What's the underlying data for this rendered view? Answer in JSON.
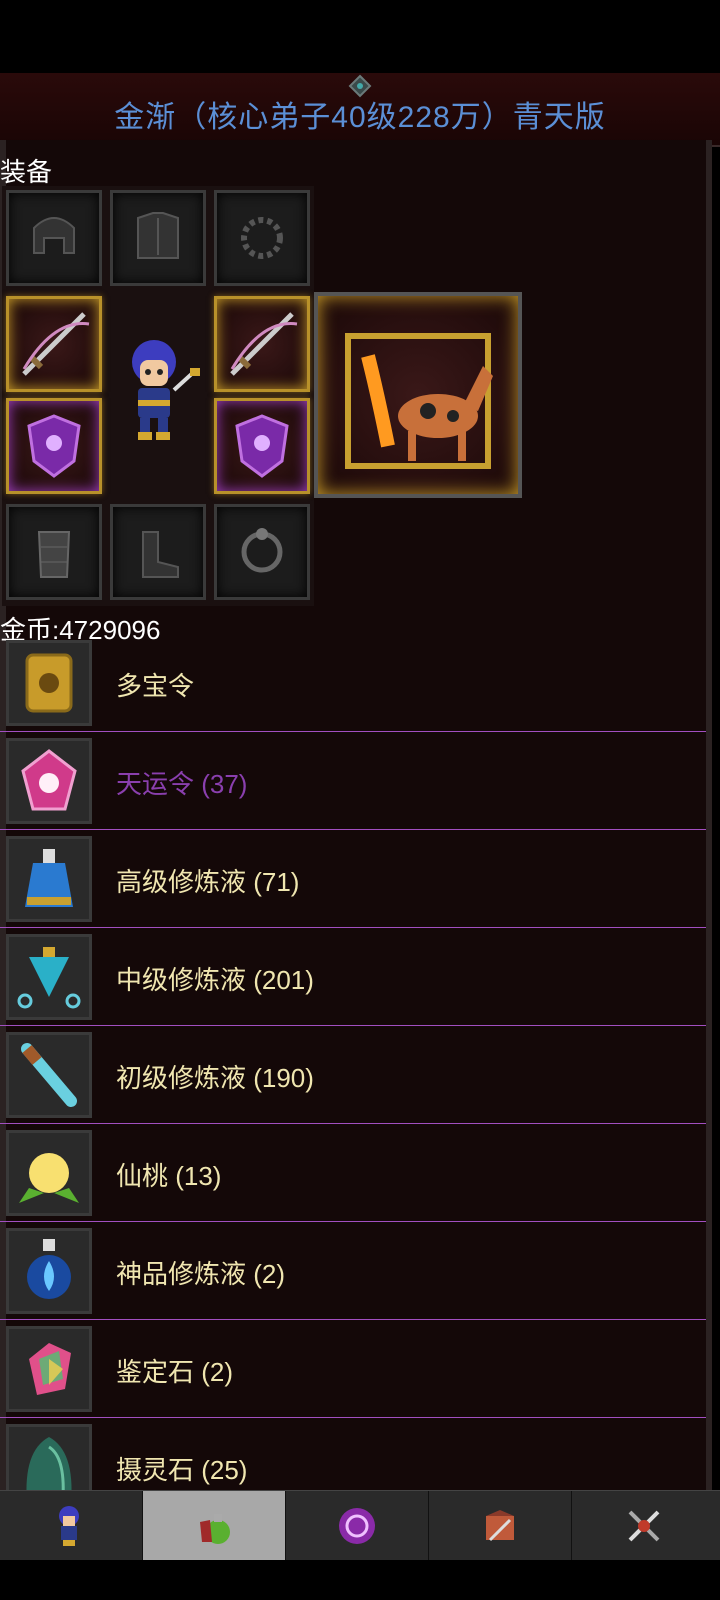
{
  "header": {
    "title": "金渐（核心弟子40级228万）青天版"
  },
  "equipment": {
    "section_label": "装备",
    "slots": [
      {
        "name": "helmet",
        "icon": "helmet-icon",
        "equipped": false
      },
      {
        "name": "armor",
        "icon": "armor-icon",
        "equipped": false
      },
      {
        "name": "necklace",
        "icon": "bead-necklace-icon",
        "equipped": false
      },
      {
        "name": "weapon-left",
        "icon": "sword-icon",
        "equipped": true
      },
      {
        "name": "weapon-right",
        "icon": "sword-icon",
        "equipped": true
      },
      {
        "name": "shield-left",
        "icon": "shield-icon",
        "equipped": true
      },
      {
        "name": "shield-right",
        "icon": "shield-icon",
        "equipped": true
      },
      {
        "name": "gloves",
        "icon": "bracer-icon",
        "equipped": false
      },
      {
        "name": "boots",
        "icon": "boots-icon",
        "equipped": false
      },
      {
        "name": "bracelet",
        "icon": "bracelet-icon",
        "equipped": false
      },
      {
        "name": "mount",
        "icon": "fire-horse-icon",
        "equipped": true
      }
    ]
  },
  "gold": {
    "text": "金币:4729096"
  },
  "items": [
    {
      "label": "多宝令",
      "icon": "golden-token-icon",
      "color": "#f0e6b0"
    },
    {
      "label": "天运令 (37)",
      "icon": "pink-token-icon",
      "color": "#8a3fae"
    },
    {
      "label": "高级修炼液 (71)",
      "icon": "blue-potion-icon",
      "color": "#f0e6b0"
    },
    {
      "label": "中级修炼液 (201)",
      "icon": "teal-potion-icon",
      "color": "#f0e6b0"
    },
    {
      "label": "初级修炼液 (190)",
      "icon": "vial-icon",
      "color": "#f0e6b0"
    },
    {
      "label": "仙桃 (13)",
      "icon": "peach-icon",
      "color": "#f0e6b0"
    },
    {
      "label": "神品修炼液 (2)",
      "icon": "flame-potion-icon",
      "color": "#f0e6b0"
    },
    {
      "label": "鉴定石 (2)",
      "icon": "rainbow-gem-icon",
      "color": "#f0e6b0"
    },
    {
      "label": "摄灵石 (25)",
      "icon": "green-stone-icon",
      "color": "#f0e6b0"
    }
  ],
  "nav": {
    "tabs": [
      {
        "icon": "hero-icon",
        "active": false
      },
      {
        "icon": "potion-bag-icon",
        "active": true
      },
      {
        "icon": "magic-orb-icon",
        "active": false
      },
      {
        "icon": "battle-map-icon",
        "active": false
      },
      {
        "icon": "crossed-swords-icon",
        "active": false
      }
    ]
  }
}
